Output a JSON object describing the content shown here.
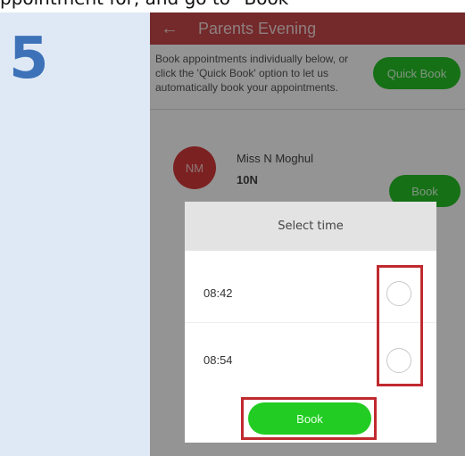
{
  "instruction": {
    "top_text": "ppointment for, and go to \"Book\"",
    "step_number": "5"
  },
  "appbar": {
    "back_icon": "arrow-left-icon",
    "title": "Parents Evening"
  },
  "intro": {
    "text": "Book appointments individually below, or click the 'Quick Book' option to let us automatically book your appointments.",
    "quick_book_label": "Quick Book"
  },
  "teacher": {
    "initials": "NM",
    "name": "Miss N Moghul",
    "class": "10N",
    "book_label": "Book"
  },
  "dialog": {
    "title": "Select time",
    "times": [
      {
        "label": "08:42"
      },
      {
        "label": "08:54"
      }
    ],
    "book_label": "Book"
  },
  "colors": {
    "appbar": "#c9474a",
    "accent_green": "#27c227",
    "avatar": "#d63a3a",
    "highlight": "#c02a2f",
    "step_number": "#3d72b8"
  }
}
